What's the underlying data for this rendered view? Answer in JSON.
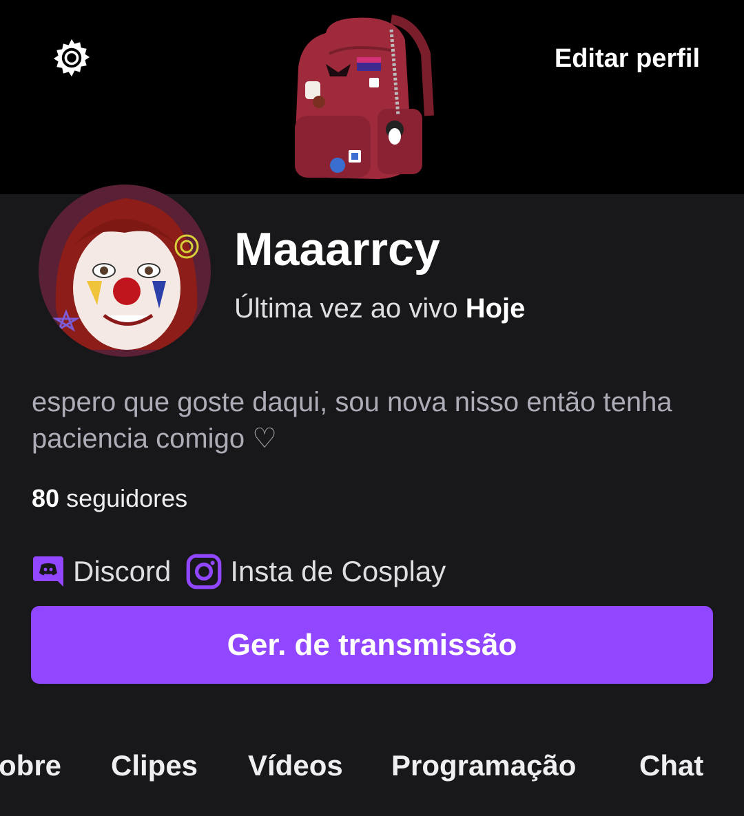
{
  "header": {
    "settings_icon": "gear-icon",
    "edit_profile_label": "Editar perfil"
  },
  "profile": {
    "channel_name": "Maaarrcy",
    "last_live_prefix": "Última vez ao vivo",
    "last_live_value": "Hoje",
    "bio": "espero que goste daqui, sou nova nisso então tenha paciencia comigo ♡",
    "followers_count": "80",
    "followers_label": "seguidores"
  },
  "links": [
    {
      "label": "Discord",
      "icon": "discord-icon"
    },
    {
      "label": "Insta de Cosplay",
      "icon": "instagram-icon"
    }
  ],
  "primary_button_label": "Ger. de transmissão",
  "tabs": [
    {
      "label": "Sobre"
    },
    {
      "label": "Clipes"
    },
    {
      "label": "Vídeos"
    },
    {
      "label": "Programação"
    },
    {
      "label": "Chat"
    }
  ],
  "colors": {
    "accent": "#9147ff",
    "background": "#18181b",
    "banner": "#000000"
  }
}
